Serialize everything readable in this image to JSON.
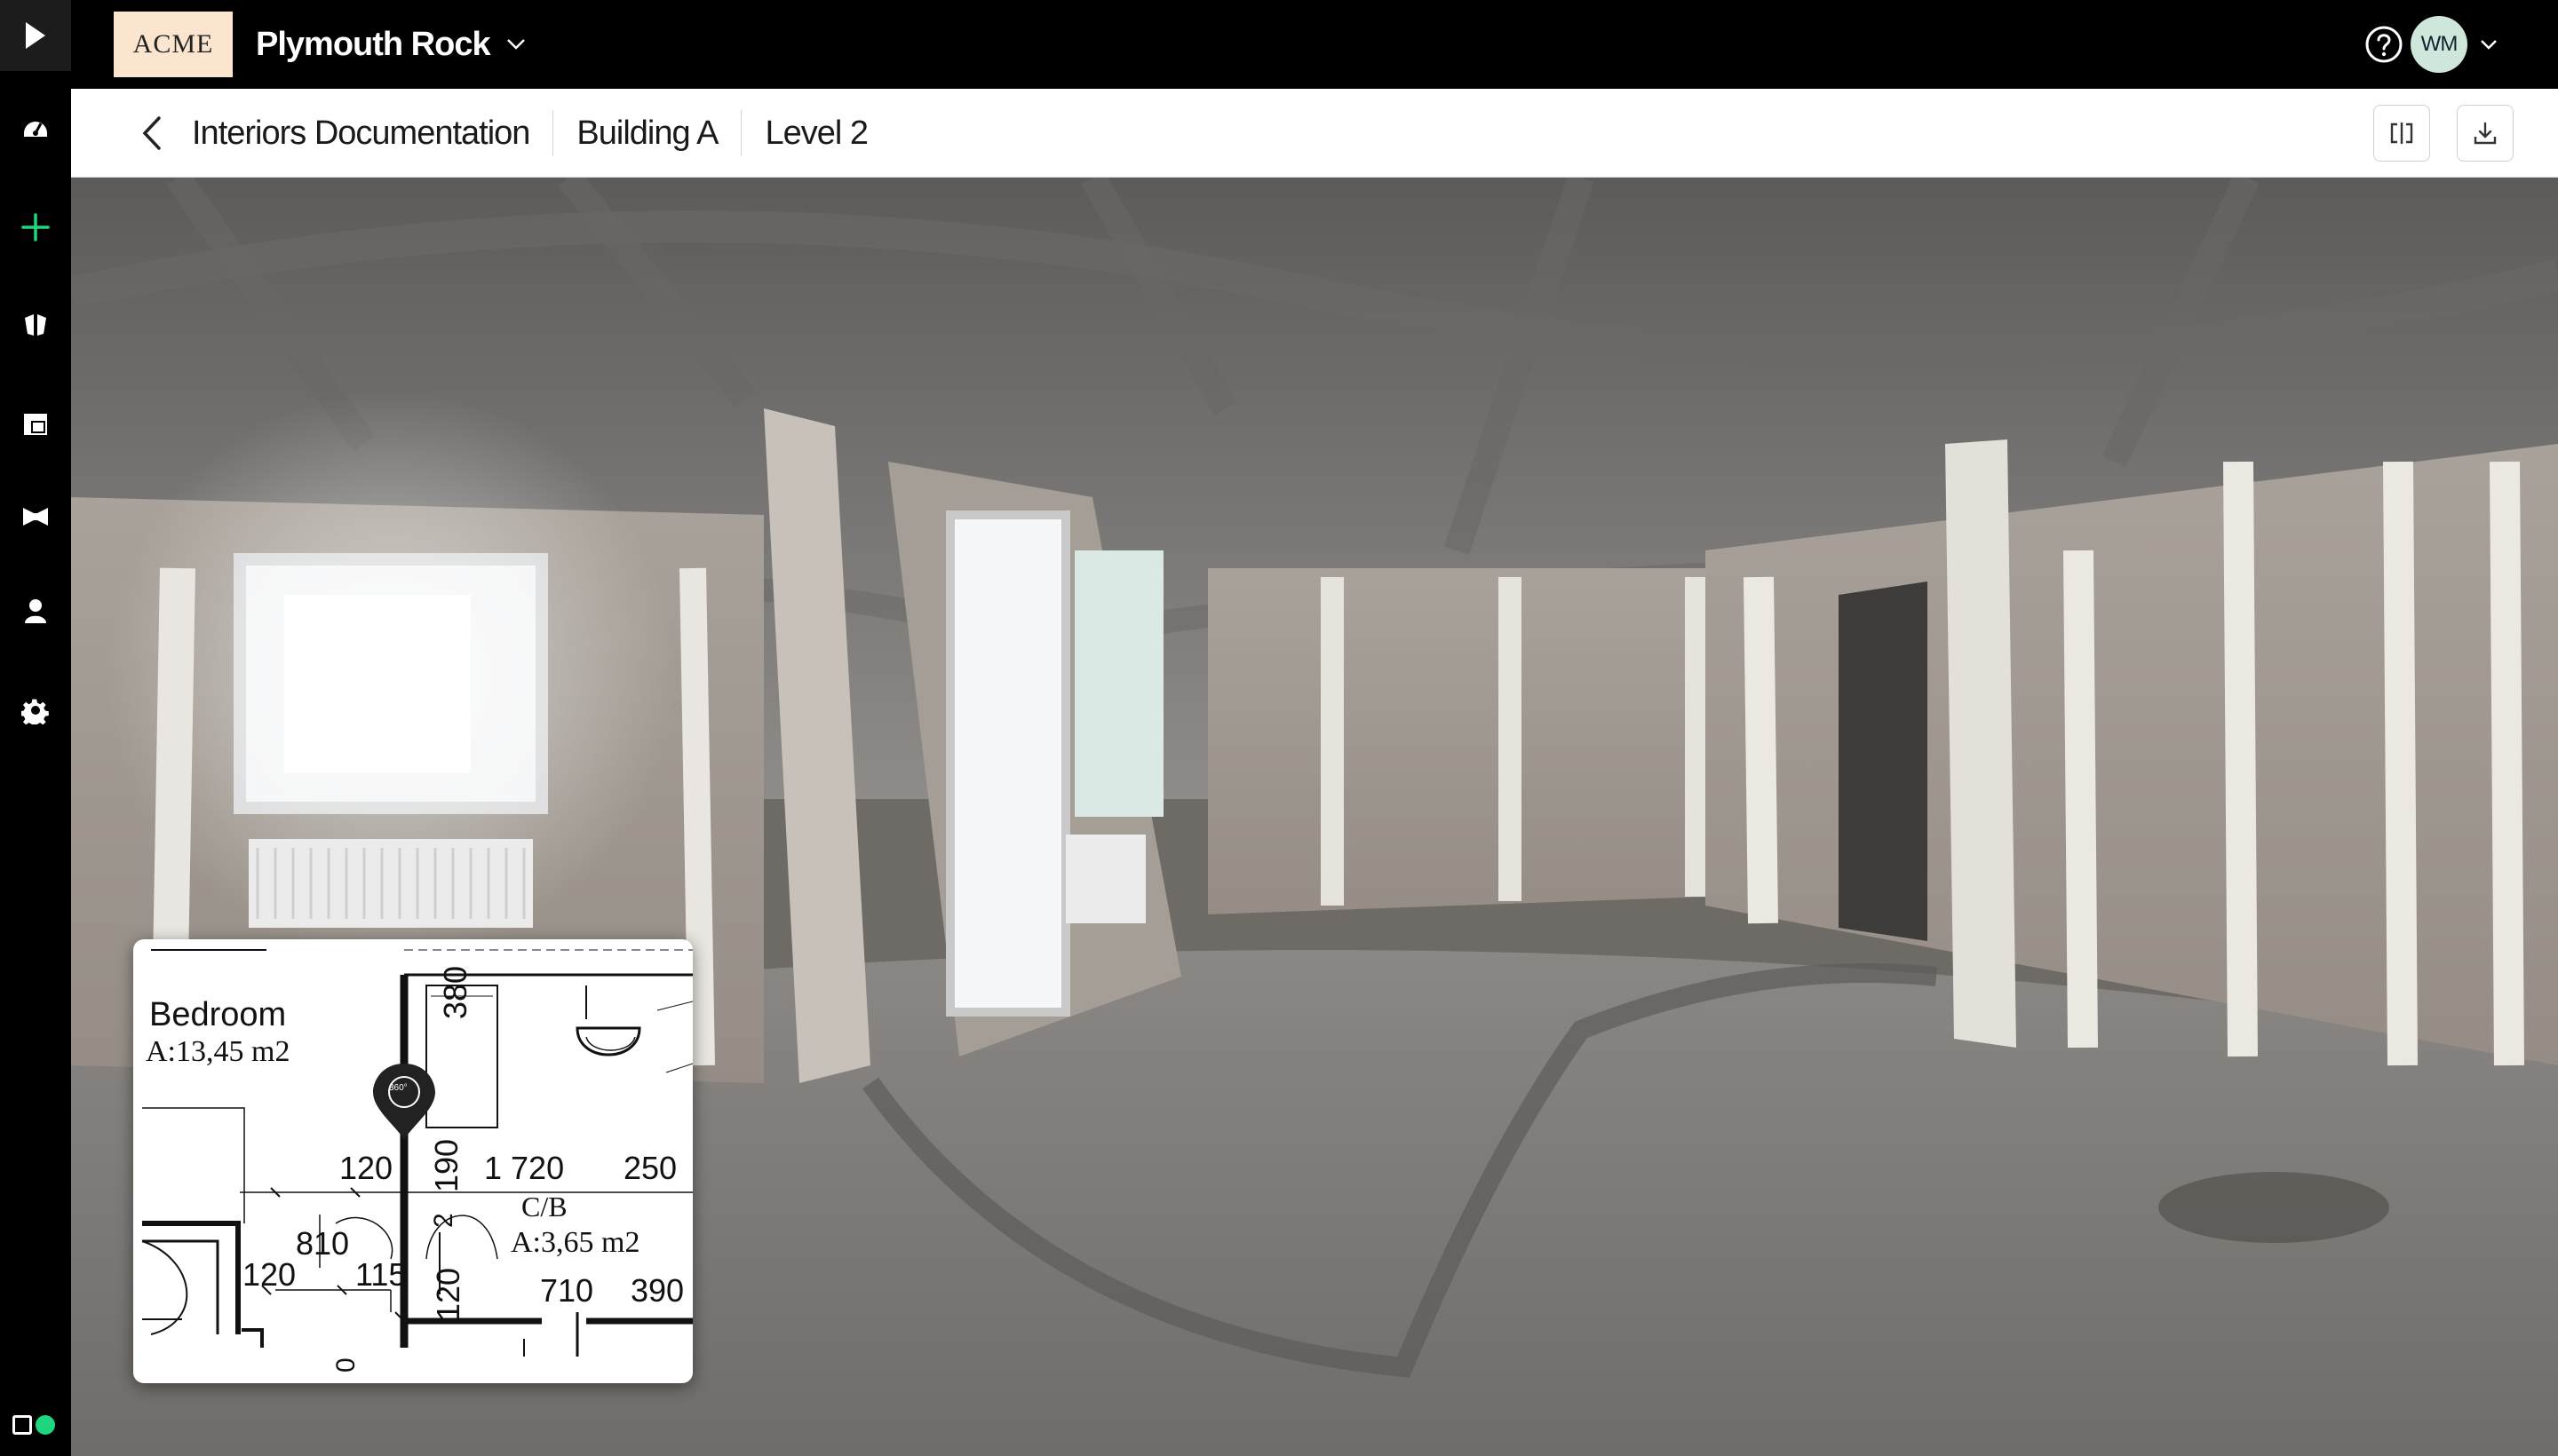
{
  "topbar": {
    "logo_text": "ACME",
    "project_name": "Plymouth Rock",
    "user_initials": "WM"
  },
  "breadcrumbs": [
    "Interiors Documentation",
    "Building A",
    "Level 2"
  ],
  "floorplan": {
    "room1_name": "Bedroom",
    "room1_area": "A:13,45 m2",
    "room2_name": "C/B",
    "room2_area": "A:3,65 m2",
    "dims": {
      "d380": "380",
      "d120a": "120",
      "d190": "190",
      "d1720": "1 720",
      "d250": "250",
      "d2": "2",
      "d810": "810",
      "d120b": "120",
      "d115": "115",
      "d120c": "120",
      "d710": "710",
      "d390": "390",
      "d0": "0"
    },
    "pin_label": "360°"
  },
  "colors": {
    "accent_green": "#1ed67e",
    "logo_bg": "#fbe5cf",
    "avatar_bg": "#cfe6da"
  }
}
